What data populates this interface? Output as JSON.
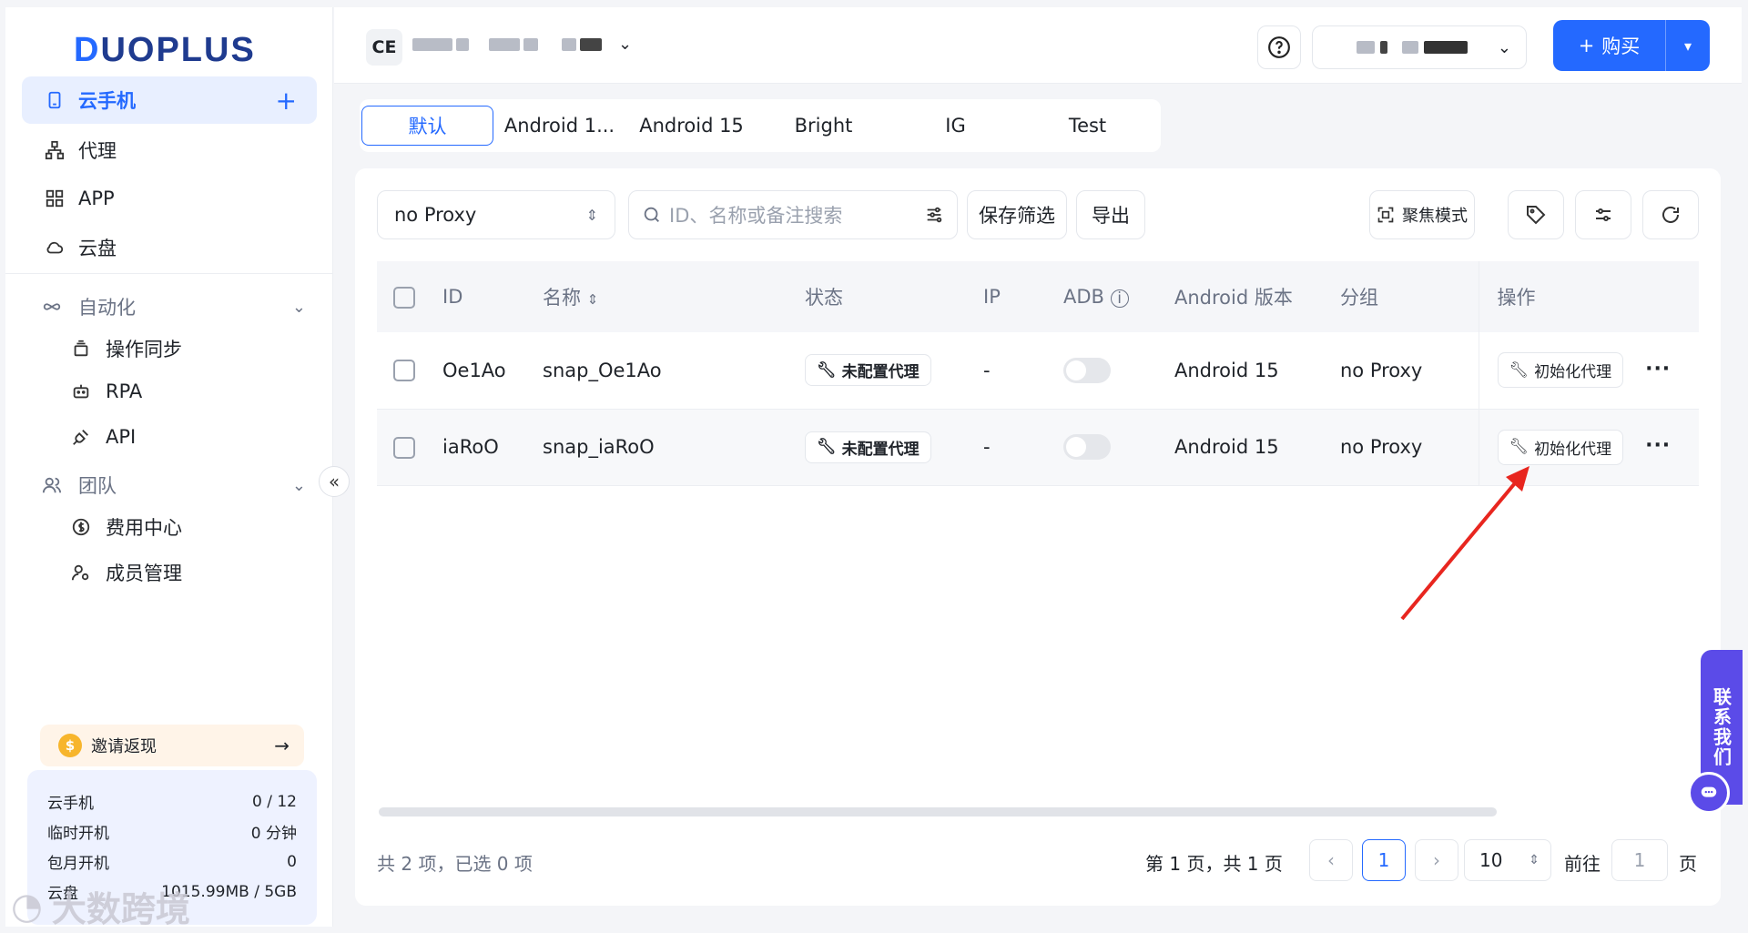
{
  "logo": {
    "first": "D",
    "rest": "UOPLUS"
  },
  "sidebar": {
    "cloud_phone": "云手机",
    "plus": "+",
    "proxy": "代理",
    "app": "APP",
    "cloud_disk": "云盘",
    "automation": "自动化",
    "sync_ops": "操作同步",
    "rpa": "RPA",
    "api": "API",
    "team": "团队",
    "billing": "费用中心",
    "members": "成员管理",
    "invite": "邀请返现",
    "invite_arrow": "→",
    "collapse": "«",
    "usage": [
      {
        "label": "云手机",
        "value": "0 / 12"
      },
      {
        "label": "临时开机",
        "value": "0 分钟"
      },
      {
        "label": "包月开机",
        "value": "0"
      },
      {
        "label": "云盘",
        "value": "1015.99MB / 5GB"
      }
    ]
  },
  "header": {
    "org_badge": "CE",
    "buy_label": "购买",
    "buy_plus": "+"
  },
  "tabs": [
    "默认",
    "Android 1...",
    "Android 15",
    "Bright",
    "IG",
    "Test"
  ],
  "toolbar": {
    "proxy_filter": "no Proxy",
    "search_placeholder": "ID、名称或备注搜索",
    "save_filter": "保存筛选",
    "export": "导出",
    "focus_mode": "聚焦模式"
  },
  "table": {
    "headers": {
      "id": "ID",
      "name": "名称",
      "status": "状态",
      "ip": "IP",
      "adb": "ADB",
      "android": "Android 版本",
      "group": "分组",
      "action": "操作"
    },
    "rows": [
      {
        "id": "Oe1Ao",
        "name": "snap_Oe1Ao",
        "status": "未配置代理",
        "ip": "-",
        "android": "Android 15",
        "group": "no Proxy",
        "action": "初始化代理",
        "adb_on": false
      },
      {
        "id": "iaRoO",
        "name": "snap_iaRoO",
        "status": "未配置代理",
        "ip": "-",
        "android": "Android 15",
        "group": "no Proxy",
        "action": "初始化代理",
        "adb_on": false
      }
    ]
  },
  "footer": {
    "summary": "共 2 项，已选 0 项",
    "page_info": "第 1 页，共 1 页",
    "current_page": "1",
    "page_size": "10",
    "goto_label": "前往",
    "goto_value": "1",
    "goto_suffix": "页"
  },
  "contact": "联系我们",
  "watermark": "大数跨境",
  "colors": {
    "accent": "#2469ff",
    "contact": "#5b4be8",
    "arrow": "#e8261f"
  }
}
